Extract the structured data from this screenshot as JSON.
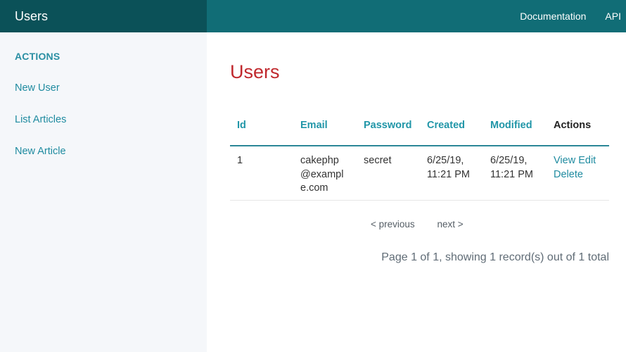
{
  "topbar": {
    "brand": "Users",
    "nav": [
      "Documentation",
      "API"
    ]
  },
  "sidebar": {
    "heading": "ACTIONS",
    "links": [
      "New User",
      "List Articles",
      "New Article"
    ]
  },
  "main": {
    "title": "Users",
    "table": {
      "headers": [
        "Id",
        "Email",
        "Password",
        "Created",
        "Modified",
        "Actions"
      ],
      "rows": [
        {
          "id": "1",
          "email_lines": [
            "cakephp",
            "@exampl",
            "e.com"
          ],
          "password": "secret",
          "created_lines": [
            "6/25/19,",
            "11:21 PM"
          ],
          "modified_lines": [
            "6/25/19,",
            "11:21 PM"
          ],
          "actions": [
            "View",
            "Edit",
            "Delete"
          ]
        }
      ]
    },
    "paginator": {
      "previous": "< previous",
      "next": "next >"
    },
    "counter": "Page 1 of 1, showing 1 record(s) out of 1 total"
  },
  "colors": {
    "topbar": "#116d76",
    "brand_bg": "#0b5158",
    "sidebar_bg": "#f5f7fa",
    "link": "#1f8ba0",
    "title": "#c0282d"
  }
}
